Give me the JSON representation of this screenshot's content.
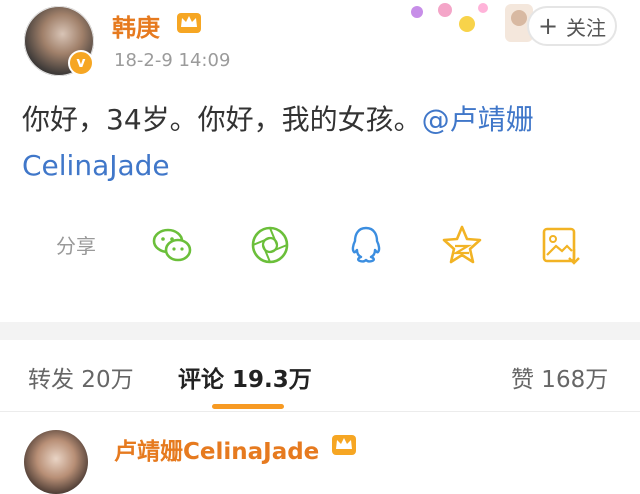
{
  "post": {
    "author": "韩庚",
    "timestamp": "18-2-9 14:09",
    "text_plain": "你好，34岁。你好，我的女孩。",
    "mention": "@卢靖姗CelinaJade",
    "follow_label": "关注",
    "follow_plus": "+",
    "avatar_badge": "v"
  },
  "share": {
    "label": "分享",
    "icons": [
      "wechat-icon",
      "moments-icon",
      "qq-icon",
      "qzone-icon",
      "save-image-icon"
    ]
  },
  "tabs": {
    "repost": "转发 20万",
    "comments": "评论 19.3万",
    "likes": "赞 168万"
  },
  "comment": {
    "author": "卢靖姗CelinaJade"
  },
  "colors": {
    "accent_orange": "#e67a1f",
    "mention_blue": "#4077c9",
    "share_green": "#6bbf3a",
    "share_blue": "#3c8ee0",
    "share_gold": "#f2b324"
  }
}
